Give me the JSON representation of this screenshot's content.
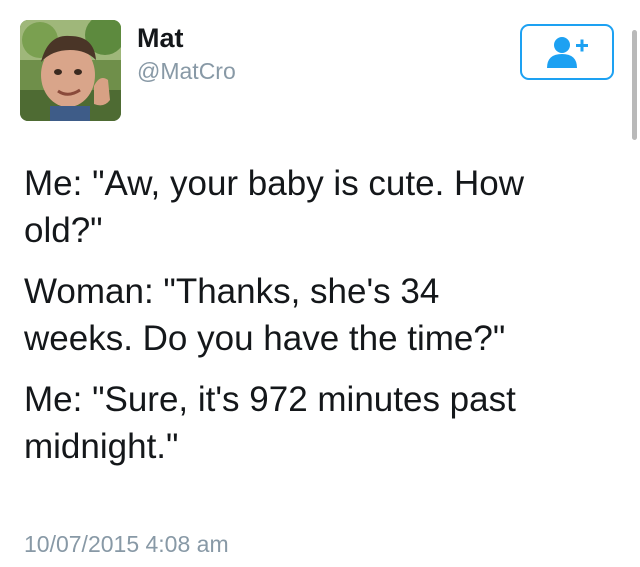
{
  "author": {
    "name": "Mat",
    "handle": "@MatCro"
  },
  "follow_button": {
    "icon": "add-user-icon",
    "color": "#1da1f2"
  },
  "tweet": {
    "paragraphs": [
      "Me: \"Aw, your baby is cute. How\nold?\"",
      "Woman: \"Thanks, she's 34\nweeks. Do you have the time?\"",
      "Me: \"Sure, it's 972 minutes past\nmidnight.\""
    ],
    "timestamp": "10/07/2015 4:08 am"
  },
  "colors": {
    "text": "#14171a",
    "muted": "#8899a6",
    "accent": "#1da1f2"
  }
}
